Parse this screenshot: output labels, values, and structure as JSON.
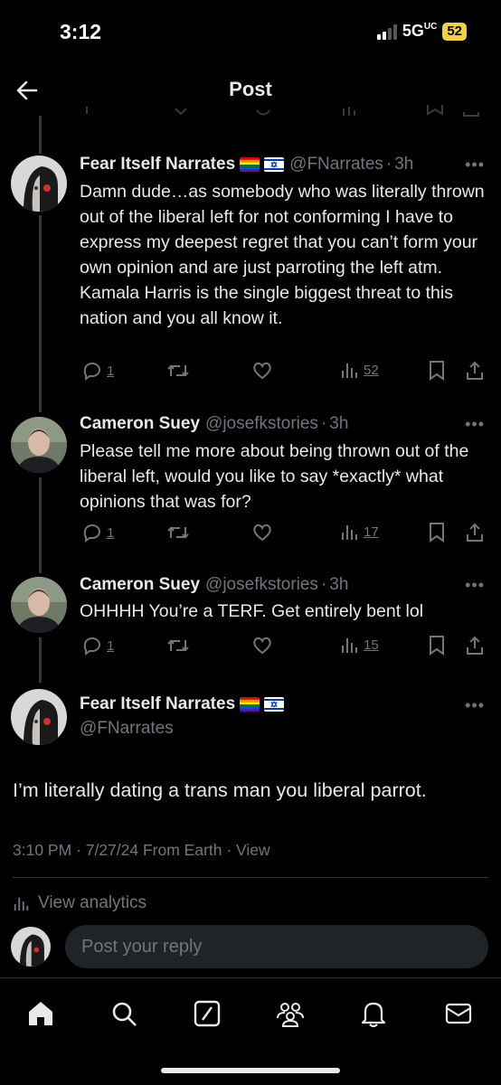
{
  "status": {
    "time": "3:12",
    "network": "5G",
    "network_sub": "UC",
    "battery": "52"
  },
  "header": {
    "title": "Post"
  },
  "tweets": [
    {
      "name": "Fear Itself Narrates",
      "handle": "@FNarrates",
      "time": "3h",
      "text": "Damn dude…as somebody who was literally thrown out of the liberal left for not conforming I have to express my deepest regret that you can’t form your own opinion and are just parroting the left atm. Kamala Harris is the single biggest threat to this nation and you all know it.",
      "replies": "1",
      "views": "52"
    },
    {
      "name": "Cameron Suey",
      "handle": "@josefkstories",
      "time": "3h",
      "text": "Please tell me more about being thrown out of the liberal left, would you like to say *exactly* what opinions that was for?",
      "replies": "1",
      "views": "17"
    },
    {
      "name": "Cameron Suey",
      "handle": "@josefkstories",
      "time": "3h",
      "text": "OHHHH You’re a TERF. Get entirely bent lol",
      "replies": "1",
      "views": "15"
    }
  ],
  "main_post": {
    "name": "Fear Itself Narrates",
    "handle": "@FNarrates",
    "text": "I’m literally dating a trans man you liberal parrot.",
    "meta": "3:10 PM · 7/27/24 From Earth · View",
    "analytics": "View analytics"
  },
  "reply": {
    "placeholder": "Post your reply"
  },
  "colors": {
    "background": "#000000",
    "text": "#e7e9ea",
    "muted": "#71767b",
    "battery": "#f4d03f"
  },
  "icons": [
    "back-arrow-icon",
    "reply-icon",
    "retweet-icon",
    "like-icon",
    "views-icon",
    "bookmark-icon",
    "share-icon",
    "more-icon",
    "home-icon",
    "search-icon",
    "grok-icon",
    "communities-icon",
    "notifications-icon",
    "messages-icon"
  ]
}
